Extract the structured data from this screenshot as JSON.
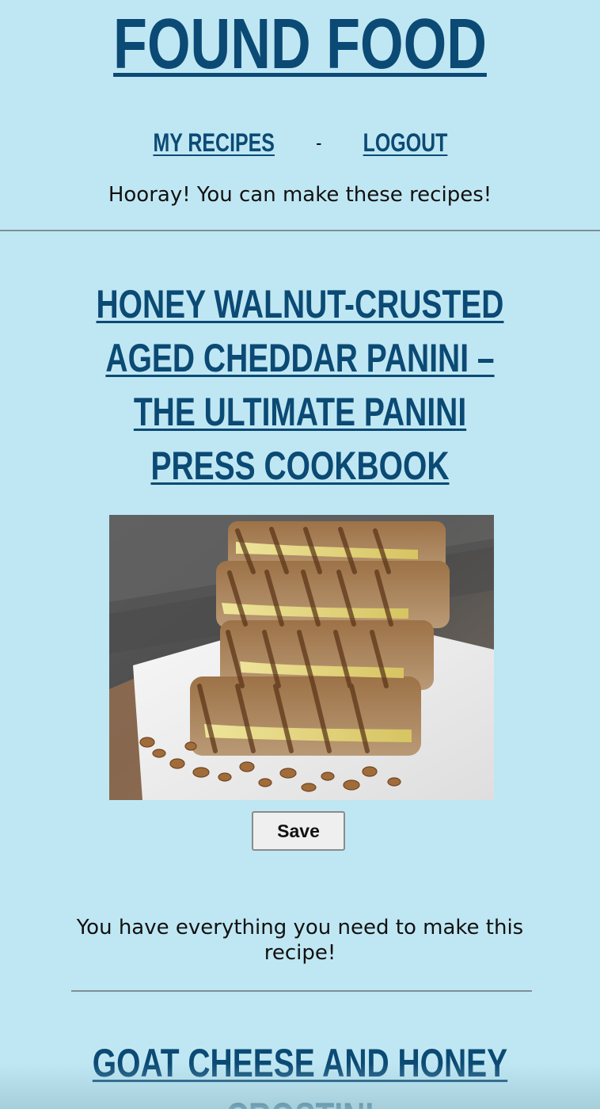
{
  "site": {
    "title": "FOUND FOOD",
    "tagline": "Hooray! You can make these recipes!"
  },
  "nav": {
    "my_recipes": "MY RECIPES",
    "separator": "-",
    "logout": "LOGOUT"
  },
  "recipes": [
    {
      "title": "HONEY WALNUT-CRUSTED AGED CHEDDAR PANINI – THE ULTIMATE PANINI PRESS COOKBOOK",
      "save_label": "Save",
      "status": "You have everything you need to make this recipe!"
    },
    {
      "title": "GOAT CHEESE AND HONEY CROSTINI"
    }
  ],
  "colors": {
    "background": "#bfe7f3",
    "accent": "#0b4a74",
    "rule": "#7f8f95"
  }
}
